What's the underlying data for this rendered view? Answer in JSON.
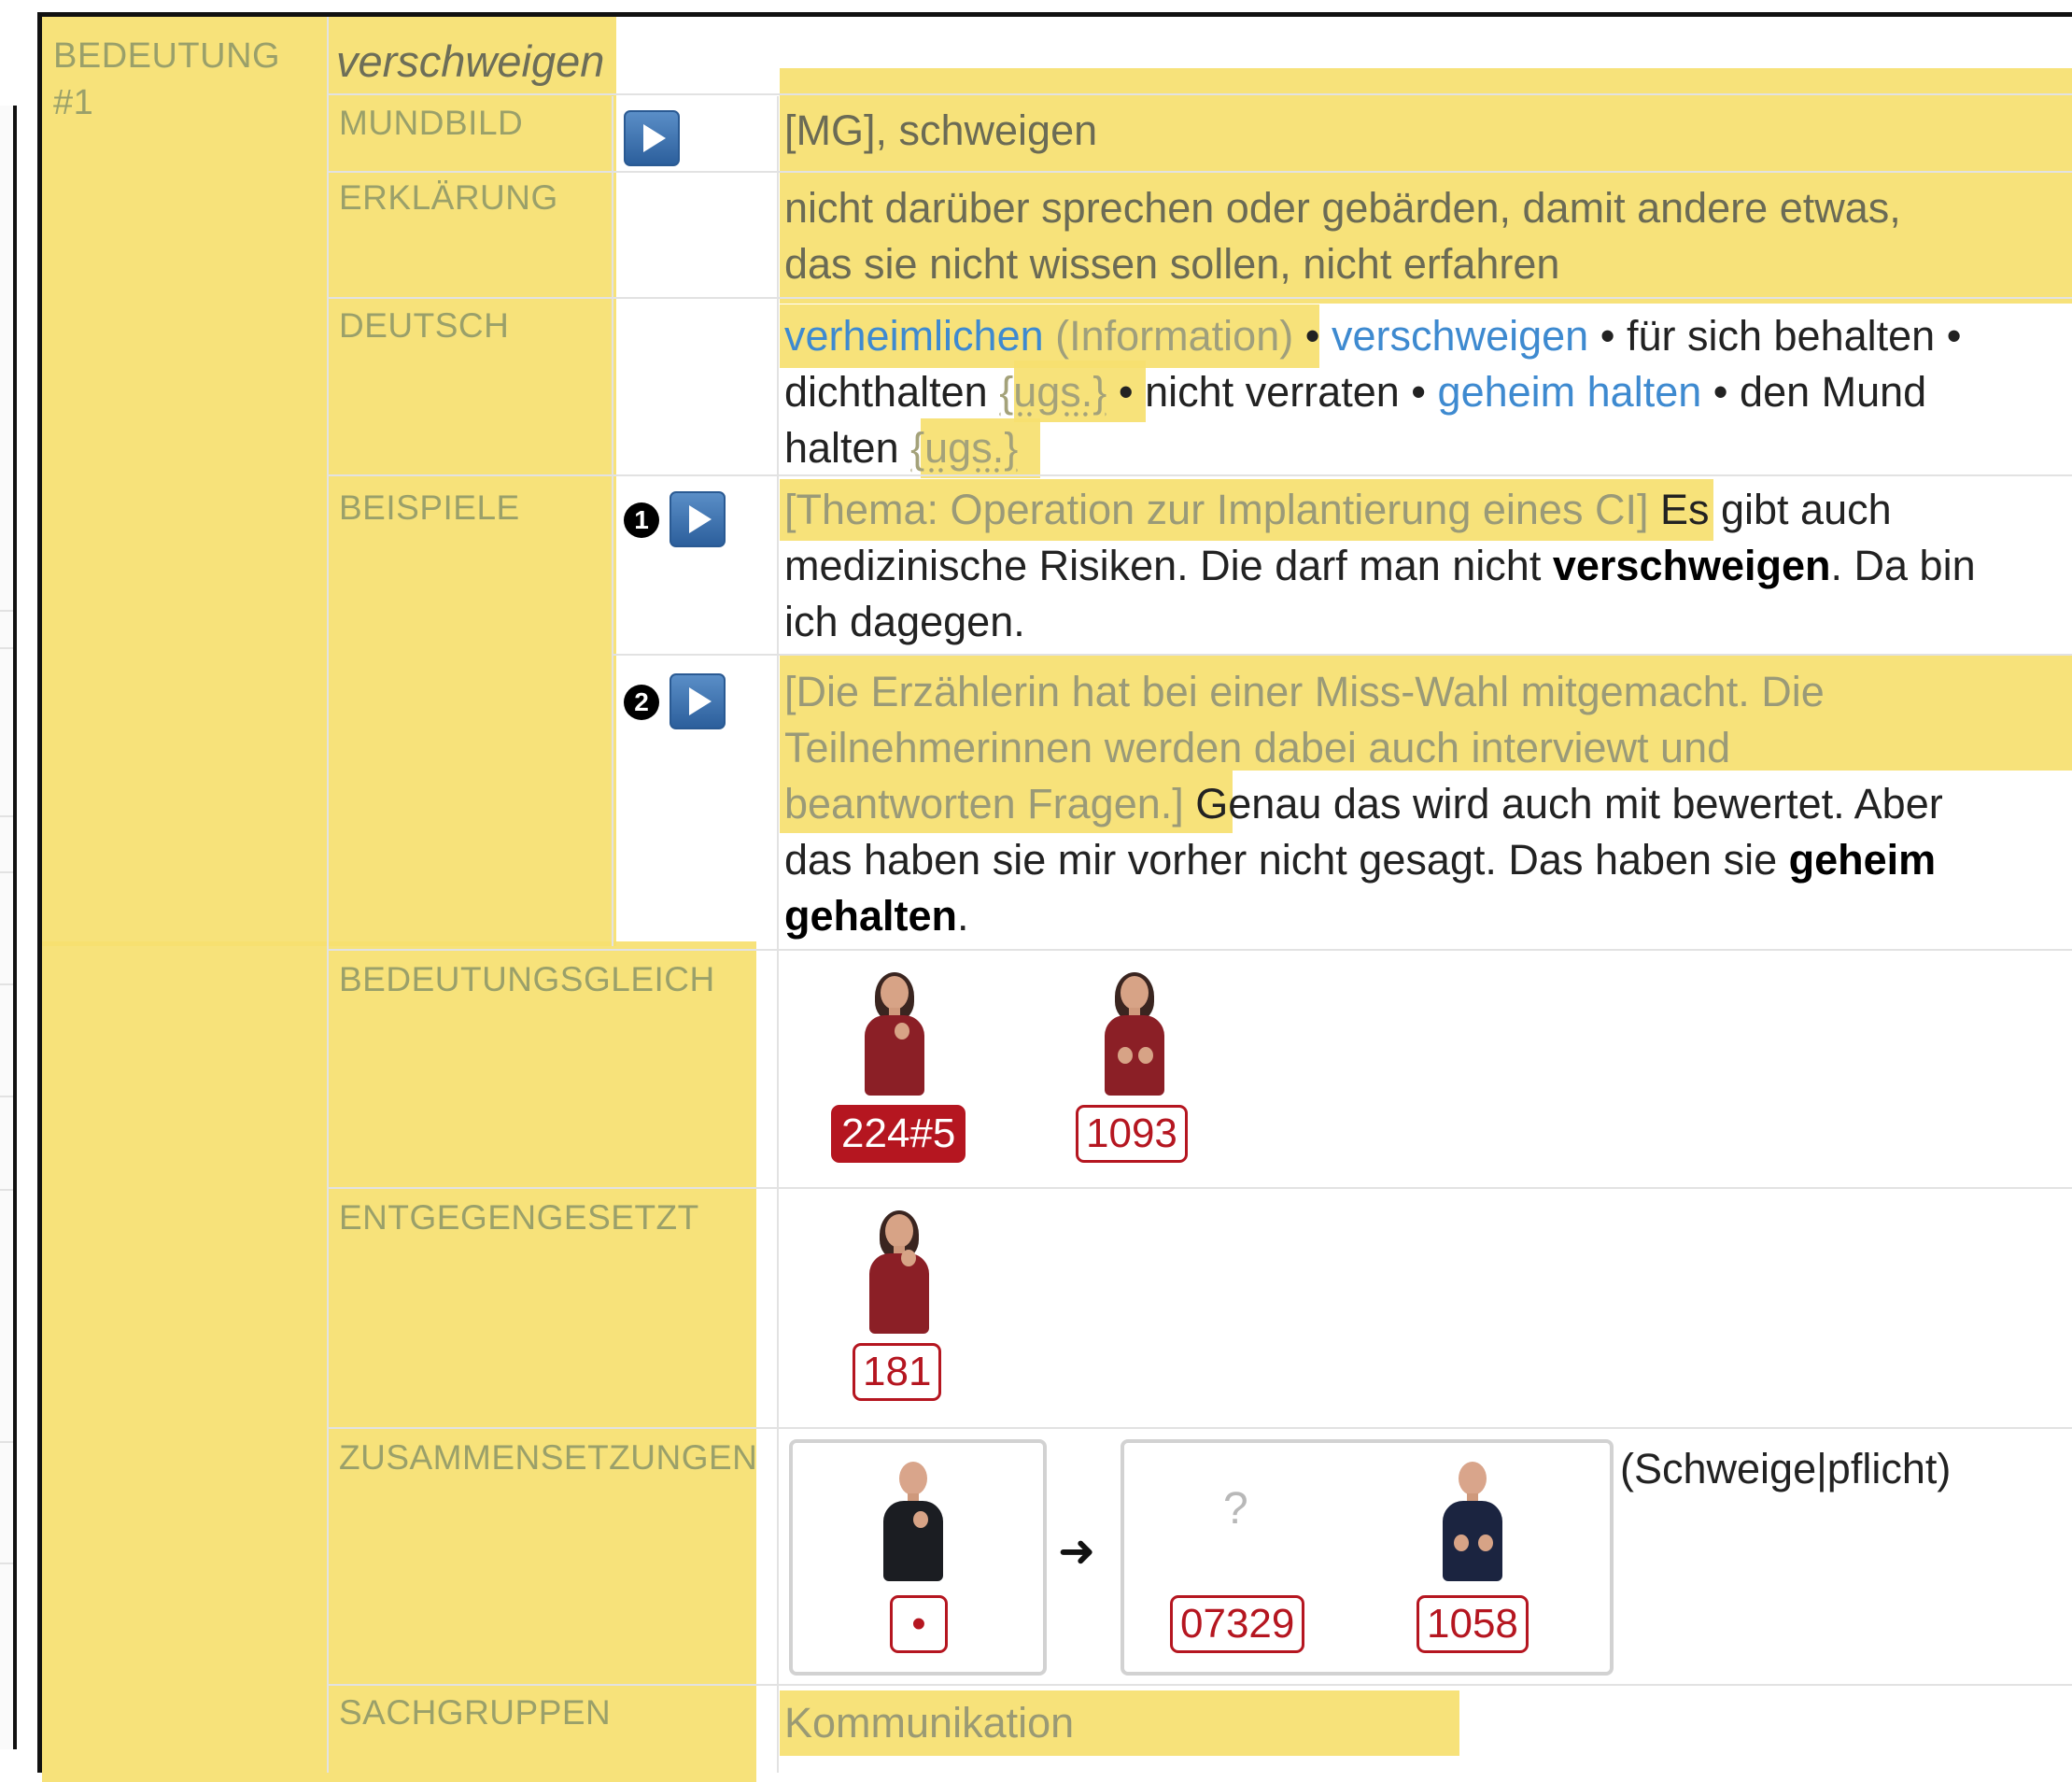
{
  "sense": {
    "label": "BEDEUTUNG",
    "number": "#1",
    "headword": "verschweigen"
  },
  "mundbild": {
    "label": "MUNDBILD",
    "text": "[MG], schweigen"
  },
  "erklaerung": {
    "label": "ERKLÄRUNG",
    "line1": "nicht darüber sprechen oder gebärden, damit andere etwas,",
    "line2": "das sie nicht wissen sollen, nicht erfahren"
  },
  "deutsch": {
    "label": "DEUTSCH",
    "items": {
      "verheimlichen": "verheimlichen",
      "information": "(Information)",
      "sep": "•",
      "verschweigen": "verschweigen",
      "fuer_sich": "für sich behalten",
      "dichthalten": "dichthalten",
      "ugs": "{ugs.}",
      "nicht_verraten": "nicht verraten",
      "geheim_halten": "geheim halten",
      "den_mund": "den Mund",
      "halten": "halten"
    }
  },
  "beispiele": {
    "label": "BEISPIELE",
    "ex1": {
      "num": "1",
      "context": "[Thema: Operation zur Implantierung eines CI]",
      "t1": "Es gibt auch",
      "t2": "medizinische Risiken. Die darf man nicht",
      "bold": "verschweigen",
      "t3": ". Da bin",
      "t4": "ich dagegen."
    },
    "ex2": {
      "num": "2",
      "context1": "[Die Erzählerin hat bei einer Miss-Wahl mitgemacht. Die",
      "context2": "Teilnehmerinnen werden dabei auch interviewt und",
      "context3": "beantworten Fragen.]",
      "t1": "Genau das wird auch mit bewertet. Aber",
      "t2": "das haben sie mir vorher nicht gesagt. Das haben sie",
      "bold1": "geheim",
      "bold2": "gehalten",
      "t3": "."
    }
  },
  "bedeutungsgleich": {
    "label": "BEDEUTUNGSGLEICH",
    "tags": [
      "224#5",
      "1093"
    ]
  },
  "entgegengesetzt": {
    "label": "ENTGEGENGESETZT",
    "tags": [
      "181"
    ]
  },
  "zusammensetzungen": {
    "label": "ZUSAMMENSETZUNGEN",
    "tags": [
      "•",
      "07329",
      "1058"
    ],
    "unknown": "?",
    "arrow": "➜",
    "compound": "(Schweige|pflicht)"
  },
  "sachgruppen": {
    "label": "SACHGRUPPEN",
    "value": "Kommunikation"
  },
  "colors": {
    "highlight": "#f6df6f",
    "link": "#3e8ad0",
    "tag_red": "#b51620"
  }
}
